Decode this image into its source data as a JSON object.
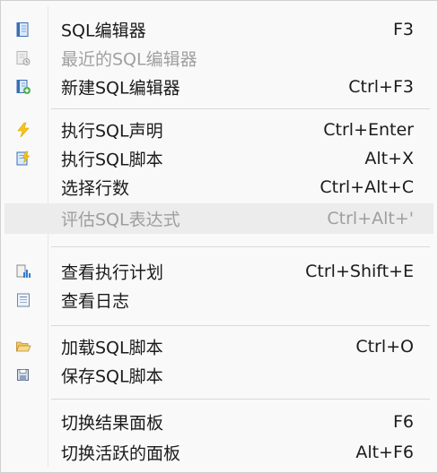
{
  "menu": {
    "groups": [
      {
        "items": [
          {
            "label": "SQL编辑器",
            "shortcut": "F3",
            "icon": "sql-editor-icon",
            "enabled": true
          },
          {
            "label": "最近的SQL编辑器",
            "shortcut": "",
            "icon": "recent-sql-editor-icon",
            "enabled": false
          },
          {
            "label": "新建SQL编辑器",
            "shortcut": "Ctrl+F3",
            "icon": "new-sql-editor-icon",
            "enabled": true
          }
        ]
      },
      {
        "items": [
          {
            "label": "执行SQL声明",
            "shortcut": "Ctrl+Enter",
            "icon": "lightning-icon",
            "enabled": true
          },
          {
            "label": "执行SQL脚本",
            "shortcut": "Alt+X",
            "icon": "run-script-icon",
            "enabled": true
          },
          {
            "label": "选择行数",
            "shortcut": "Ctrl+Alt+C",
            "icon": "",
            "enabled": true
          },
          {
            "label": "评估SQL表达式",
            "shortcut": "Ctrl+Alt+'",
            "icon": "",
            "enabled": false
          }
        ]
      },
      {
        "items": [
          {
            "label": "查看执行计划",
            "shortcut": "Ctrl+Shift+E",
            "icon": "execution-plan-icon",
            "enabled": true
          },
          {
            "label": "查看日志",
            "shortcut": "",
            "icon": "log-icon",
            "enabled": true
          }
        ]
      },
      {
        "items": [
          {
            "label": "加载SQL脚本",
            "shortcut": "Ctrl+O",
            "icon": "folder-open-icon",
            "enabled": true
          },
          {
            "label": "保存SQL脚本",
            "shortcut": "",
            "icon": "save-icon",
            "enabled": true
          }
        ]
      },
      {
        "items": [
          {
            "label": "切换结果面板",
            "shortcut": "F6",
            "icon": "",
            "enabled": true
          },
          {
            "label": "切换活跃的面板",
            "shortcut": "Alt+F6",
            "icon": "",
            "enabled": true
          }
        ]
      }
    ]
  }
}
